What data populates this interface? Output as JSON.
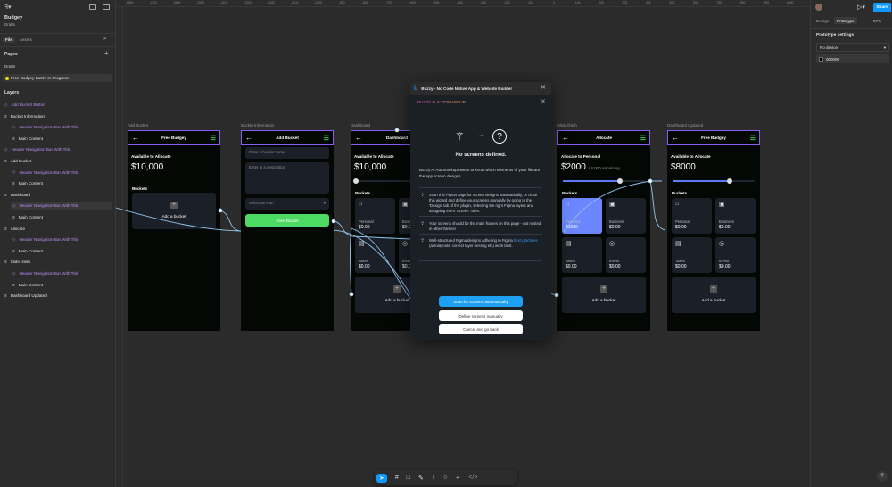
{
  "app": {
    "file_name": "Budgey",
    "location": "Drafts"
  },
  "left_panel": {
    "tabs": [
      "File",
      "Assets"
    ],
    "pages_title": "Pages",
    "pages": [
      "Drafts",
      "Free Budgey Buzzy In Progress"
    ],
    "layers_title": "Layers",
    "layers": [
      {
        "label": "Add Bucket Button",
        "type": "component",
        "indent": 0
      },
      {
        "label": "Bucket Information",
        "type": "frame",
        "indent": 0
      },
      {
        "label": "Header Navigation Bar With Title",
        "type": "component",
        "indent": 1
      },
      {
        "label": "Main Content",
        "type": "frame",
        "indent": 1
      },
      {
        "label": "Header Navigation Bar With Title",
        "type": "component",
        "indent": 0
      },
      {
        "label": "Add Bucket",
        "type": "frame",
        "indent": 0
      },
      {
        "label": "Header Navigation Bar With Title",
        "type": "component",
        "indent": 1
      },
      {
        "label": "Main Content",
        "type": "frame",
        "indent": 1
      },
      {
        "label": "Dashboard",
        "type": "frame",
        "indent": 0
      },
      {
        "label": "Header Navigation Bar With Title",
        "type": "component",
        "indent": 1,
        "selected": true
      },
      {
        "label": "Main Content",
        "type": "frame",
        "indent": 1
      },
      {
        "label": "Allocate",
        "type": "frame",
        "indent": 0
      },
      {
        "label": "Header Navigation Bar With Title",
        "type": "component",
        "indent": 1
      },
      {
        "label": "Main Content",
        "type": "frame",
        "indent": 1
      },
      {
        "label": "Slide finish",
        "type": "frame",
        "indent": 0
      },
      {
        "label": "Header Navigation Bar With Title",
        "type": "component",
        "indent": 1
      },
      {
        "label": "Main Content",
        "type": "frame",
        "indent": 1
      },
      {
        "label": "Dashboard Updated",
        "type": "frame",
        "indent": 0
      }
    ]
  },
  "right_panel": {
    "share_label": "Share",
    "tabs": [
      "Design",
      "Prototype"
    ],
    "active_tab": "Prototype",
    "zoom": "67%",
    "section_title": "Prototype settings",
    "device": "No device",
    "background_color": "000000"
  },
  "ruler": [
    "-1800",
    "-1700",
    "-1600",
    "-1500",
    "-1400",
    "-1300",
    "-1200",
    "-1100",
    "-1000",
    "-900",
    "-800",
    "-700",
    "-600",
    "-500",
    "-400",
    "-300",
    "-200",
    "-100",
    "0",
    "100",
    "200",
    "300",
    "400",
    "500",
    "600",
    "700",
    "800",
    "900",
    "1000",
    "1100"
  ],
  "frames": {
    "add_bucket": {
      "label": "Add Bucket",
      "title": "Free Budgey",
      "available": "Available to Allocate",
      "amount": "$10,000",
      "buckets": "Buckets",
      "add": "Add a bucket"
    },
    "bucket_info": {
      "label": "Bucket Information",
      "title": "Add Bucket",
      "name_placeholder": "Enter a bucket name",
      "desc_placeholder": "Enter in a description",
      "icon_placeholder": "Select an icon",
      "save": "Save Bucket"
    },
    "dashboard": {
      "label": "Dashboard",
      "title": "Dashboard",
      "available": "Available to Allocate",
      "amount": "$10,000",
      "buckets": "Buckets",
      "add": "Add a bucket",
      "slider": 0,
      "cards": [
        {
          "name": "Personal",
          "value": "$0.00"
        },
        {
          "name": "Business",
          "value": "$0.00"
        },
        {
          "name": "Taxes",
          "value": "$0.00"
        },
        {
          "name": "Invest",
          "value": "$0.00"
        }
      ]
    },
    "slide_finish": {
      "label": "Slide finish",
      "title": "Allocate",
      "available": "Allocate to Personal",
      "amount": "$2000",
      "remaining": "/ 8,000 remaining",
      "buckets": "Buckets",
      "add": "Add a bucket",
      "slider": 0.7,
      "cards": [
        {
          "name": "Personal",
          "value": "$2000"
        },
        {
          "name": "Business",
          "value": "$0.00"
        },
        {
          "name": "Taxes",
          "value": "$0.00"
        },
        {
          "name": "Invest",
          "value": "$0.00"
        }
      ]
    },
    "dashboard_updated": {
      "label": "Dashboard Updated",
      "title": "Free Budgey",
      "available": "Available to Allocate",
      "amount": "$8000",
      "buckets": "Buckets",
      "add": "Add a bucket",
      "slider": 0.7,
      "cards": [
        {
          "name": "Personal",
          "value": "$0.00"
        },
        {
          "name": "Business",
          "value": "$0.00"
        },
        {
          "name": "Taxes",
          "value": "$0.00"
        },
        {
          "name": "Invest",
          "value": "$0.00"
        }
      ]
    }
  },
  "plugin": {
    "window_title": "Buzzy - No Code Native App & Website Builder",
    "heading": "BUZZY AI AUTOMARKUP",
    "status": "No screens defined.",
    "intro": "Buzzy AI Automarkup needs to know which elements of your file are the app screen designs.",
    "tips": [
      "Scan this Figma page for screen designs automatically, or close this wizard and define your screens manually by going to the 'Design' tab of the plugin, selecting the right Figma layers and assigning them 'Screen' roles.",
      "Your screens should be the main frames on this page - not nested in other frames!"
    ],
    "tip3_pre": "Well-structured Figma designs adhering to Figma ",
    "tip3_link": "best practices",
    "tip3_post": " (autolayouts, correct layer nesting etc) work best.",
    "scan_button": "Scan for screens automatically",
    "manual_button": "Define screens manually",
    "cancel_button": "Cancel and go back"
  },
  "toolbar": [
    "move",
    "frame",
    "rectangle",
    "pen",
    "text",
    "comment",
    "actions",
    "dev-mode"
  ],
  "colors": {
    "accent": "#0d99ff",
    "component": "#b58cf0",
    "frame_header": "#8a5cf6",
    "save": "#4cd964",
    "slider": "#5b7cfa",
    "selected_card": "#6b86ff"
  }
}
